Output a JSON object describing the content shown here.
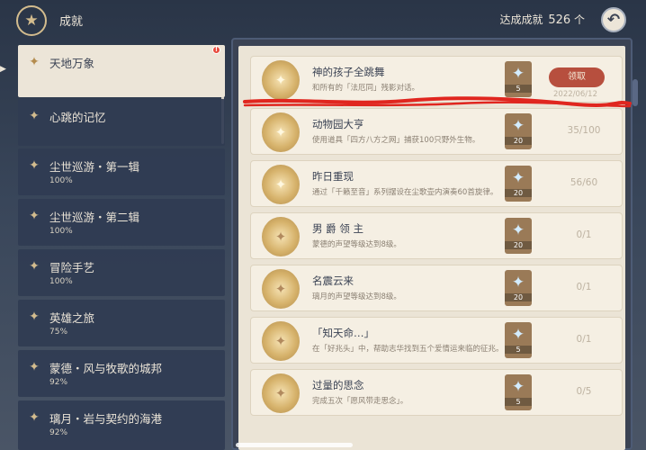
{
  "header": {
    "title": "成就",
    "achievements_label": "达成成就",
    "achievements_count": "526",
    "achievements_unit": "个"
  },
  "sidebar": {
    "notification_badge": "!",
    "items": [
      {
        "name": "天地万象",
        "percent": "",
        "icon": "medal-icon",
        "selected": true
      },
      {
        "name": "心跳的记忆",
        "percent": "",
        "icon": "medal-icon"
      },
      {
        "name": "尘世巡游・第一辑",
        "percent": "100%",
        "icon": "medal-icon"
      },
      {
        "name": "尘世巡游・第二辑",
        "percent": "100%",
        "icon": "medal-icon"
      },
      {
        "name": "冒险手艺",
        "percent": "100%",
        "icon": "medal-icon"
      },
      {
        "name": "英雄之旅",
        "percent": "75%",
        "icon": "medal-icon"
      },
      {
        "name": "蒙德・风与牧歌的城邦",
        "percent": "92%",
        "icon": "medal-icon"
      },
      {
        "name": "璃月・岩与契约的海港",
        "percent": "92%",
        "icon": "medal-icon"
      }
    ]
  },
  "achievements": [
    {
      "title": "神的孩子全跳舞",
      "desc": "和所有的「法厄同」残影对话。",
      "reward": "5",
      "action": "领取",
      "date": "2022/06/12"
    },
    {
      "title": "动物园大亨",
      "desc": "使用道具「四方八方之网」捕获100只野外生物。",
      "reward": "20",
      "progress": "35/100"
    },
    {
      "title": "昨日重现",
      "desc": "通过「千籁至音」系列摆设在尘歌壶内演奏60首旋律。",
      "reward": "20",
      "progress": "56/60"
    },
    {
      "title": "男 爵 领 主",
      "desc": "蒙德的声望等级达到8级。",
      "reward": "20",
      "progress": "0/1"
    },
    {
      "title": "名震云来",
      "desc": "璃月的声望等级达到8级。",
      "reward": "20",
      "progress": "0/1"
    },
    {
      "title": "「知天命…」",
      "desc": "在「好兆头」中，帮助志华找到五个爱情运来临的征兆。",
      "reward": "5",
      "progress": "0/1"
    },
    {
      "title": "过量的思念",
      "desc": "完成五次「愿风带走思念」。",
      "reward": "5",
      "progress": "0/5"
    }
  ],
  "colors": {
    "accent_gold": "#d3bc8e",
    "claim_button": "#b74f3e",
    "panel_bg": "#ebe4d6",
    "text_dark": "#3b4354",
    "annotation_red": "#e0261f"
  }
}
